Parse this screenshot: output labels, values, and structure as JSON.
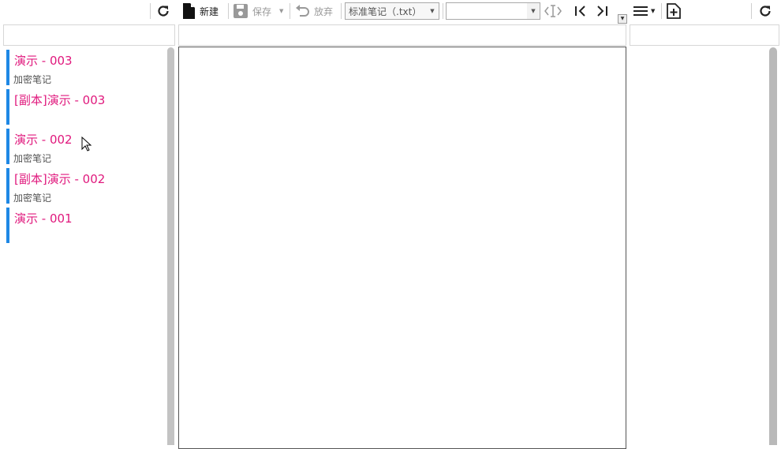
{
  "toolbar": {
    "new_label": "新建",
    "save_label": "保存",
    "discard_label": "放弃",
    "note_type": {
      "selected": "标准笔记（.txt）"
    },
    "second_select": {
      "selected": ""
    }
  },
  "filters": {
    "left": "",
    "middle": "",
    "right": ""
  },
  "notes": [
    {
      "title": "演示 - 003",
      "subtitle": "加密笔记"
    },
    {
      "title": "[副本]演示 - 003",
      "subtitle": ""
    },
    {
      "title": "演示 - 002",
      "subtitle": "加密笔记"
    },
    {
      "title": "[副本]演示 - 002",
      "subtitle": "加密笔记"
    },
    {
      "title": "演示 - 001",
      "subtitle": ""
    }
  ],
  "editor": {
    "content": ""
  },
  "colors": {
    "accent_bar": "#1e88e5",
    "note_title": "#e0197d"
  },
  "icons": [
    "refresh-icon",
    "new-file-icon",
    "save-icon",
    "undo-icon",
    "text-cursor-icon",
    "first-icon",
    "last-icon",
    "menu-icon",
    "add-file-icon",
    "refresh-icon"
  ]
}
